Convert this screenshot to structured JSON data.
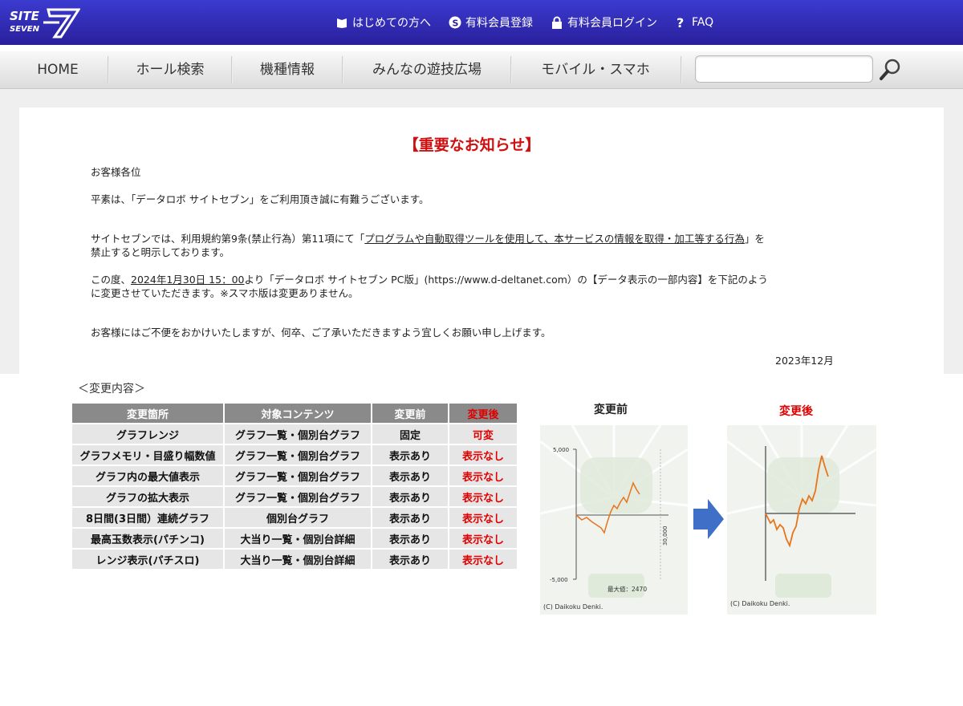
{
  "header": {
    "logo_text_top": "SITE",
    "logo_text_bottom": "SEVEN",
    "links": [
      {
        "label": "はじめての方へ",
        "icon": "book-icon"
      },
      {
        "label": "有料会員登録",
        "icon": "s-circle-icon"
      },
      {
        "label": "有料会員ログイン",
        "icon": "lock-icon"
      },
      {
        "label": "FAQ",
        "icon": "question-icon"
      }
    ]
  },
  "nav": {
    "items": [
      "HOME",
      "ホール検索",
      "機種情報",
      "みんなの遊技広場",
      "モバイル・スマホ"
    ],
    "search_value": ""
  },
  "notice": {
    "title": "【重要なお知らせ】",
    "salutation": "お客様各位",
    "p1": "平素は、「データロボ サイトセブン」をご利用頂き誠に有難うございます。",
    "p2_a": "サイトセブンでは、利用規約第9条(禁止行為）第11項にて「",
    "p2_link": "プログラムや自動取得ツールを使用して、本サービスの情報を取得・加工等する行為",
    "p2_b": "」を",
    "p2_c": "禁止すると明示しております。",
    "p3_a": "この度、",
    "p3_date": "2024年1月30日 15：00",
    "p3_b": "より「データロボ サイトセブン PC版」(https://www.d-deltanet.com）の【データ表示の一部内容】を下記のよう",
    "p3_c": "に変更させていただきます。※スマホ版は変更ありません。",
    "p4": "お客様にはご不便をおかけいたしますが、何卒、ご了承いただきますよう宜しくお願い申し上げます。",
    "date": "2023年12月"
  },
  "changes": {
    "label": "＜変更内容＞",
    "headers": [
      "変更箇所",
      "対象コンテンツ",
      "変更前",
      "変更後"
    ],
    "rows": [
      [
        "グラフレンジ",
        "グラフ一覧・個別台グラフ",
        "固定",
        "可変"
      ],
      [
        "グラフメモリ・目盛り幅数値",
        "グラフ一覧・個別台グラフ",
        "表示あり",
        "表示なし"
      ],
      [
        "グラフ内の最大値表示",
        "グラフ一覧・個別台グラフ",
        "表示あり",
        "表示なし"
      ],
      [
        "グラフの拡大表示",
        "グラフ一覧・個別台グラフ",
        "表示あり",
        "表示なし"
      ],
      [
        "8日間(3日間）連続グラフ",
        "個別台グラフ",
        "表示あり",
        "表示なし"
      ],
      [
        "最高玉数表示(パチンコ)",
        "大当り一覧・個別台詳細",
        "表示あり",
        "表示なし"
      ],
      [
        "レンジ表示(パチスロ)",
        "大当り一覧・個別台詳細",
        "表示あり",
        "表示なし"
      ]
    ]
  },
  "graphs": {
    "before_title": "変更前",
    "after_title": "変更後",
    "before_ytop": "5,000",
    "before_ybottom": "-5,000",
    "before_xlabel": "30,000",
    "before_max": "最大値：2470",
    "credit": "(C) Daikoku Denki.",
    "accent_color": "#e8741c",
    "arrow_color": "#3f6fc6"
  }
}
